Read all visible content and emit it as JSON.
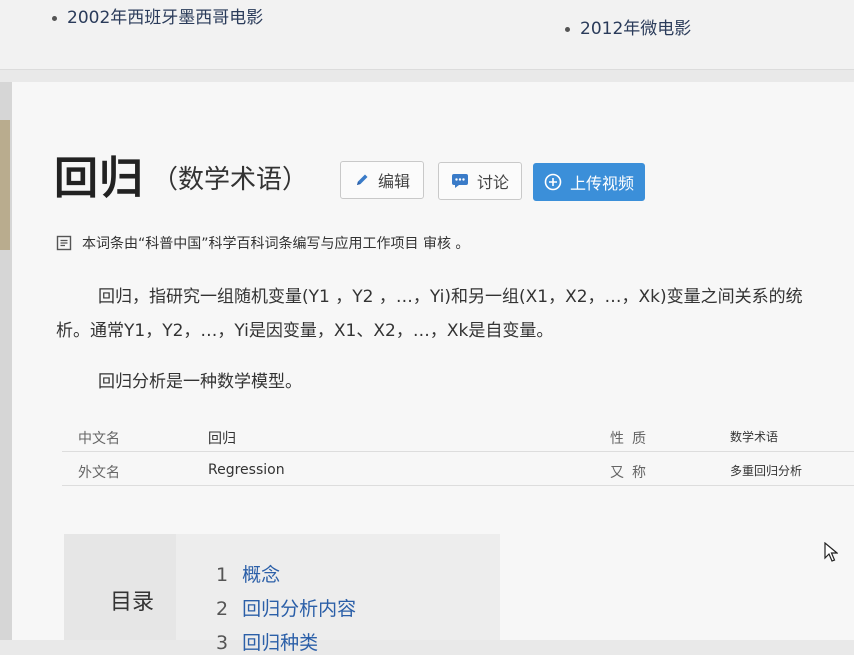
{
  "related": {
    "item1": "2002年西班牙墨西哥电影",
    "item2": "2012年微电影"
  },
  "header": {
    "title": "回归",
    "subtitle": "（数学术语）"
  },
  "buttons": {
    "edit": "编辑",
    "discuss": "讨论",
    "upload": "上传视频"
  },
  "review_note": "本词条由“科普中国”科学百科词条编写与应用工作项目 审核 。",
  "paragraphs": [
    "回归，指研究一组随机变量(Y1 ，Y2 ，…，Yi)和另一组(X1，X2，…，Xk)变量之间关系的统",
    "析。通常Y1，Y2，…，Yi是因变量，X1、X2，…，Xk是自变量。",
    "回归分析是一种数学模型。"
  ],
  "info_table": [
    {
      "key1": "中文名",
      "val1": "回归",
      "key2": "性质",
      "val2": "数学术语"
    },
    {
      "key1": "外文名",
      "val1": "Regression",
      "key2": "又称",
      "val2": "多重回归分析"
    }
  ],
  "toc": {
    "label": "目录",
    "items": [
      {
        "num": "1",
        "text": "概念"
      },
      {
        "num": "2",
        "text": "回归分析内容"
      },
      {
        "num": "3",
        "text": "回归种类"
      }
    ]
  },
  "colors": {
    "accent": "#3b8fd9",
    "link": "#2b5fa8"
  },
  "icons": {
    "edit": "pencil-icon",
    "discuss": "chat-icon",
    "upload": "plus-circle-icon",
    "review": "document-icon"
  }
}
